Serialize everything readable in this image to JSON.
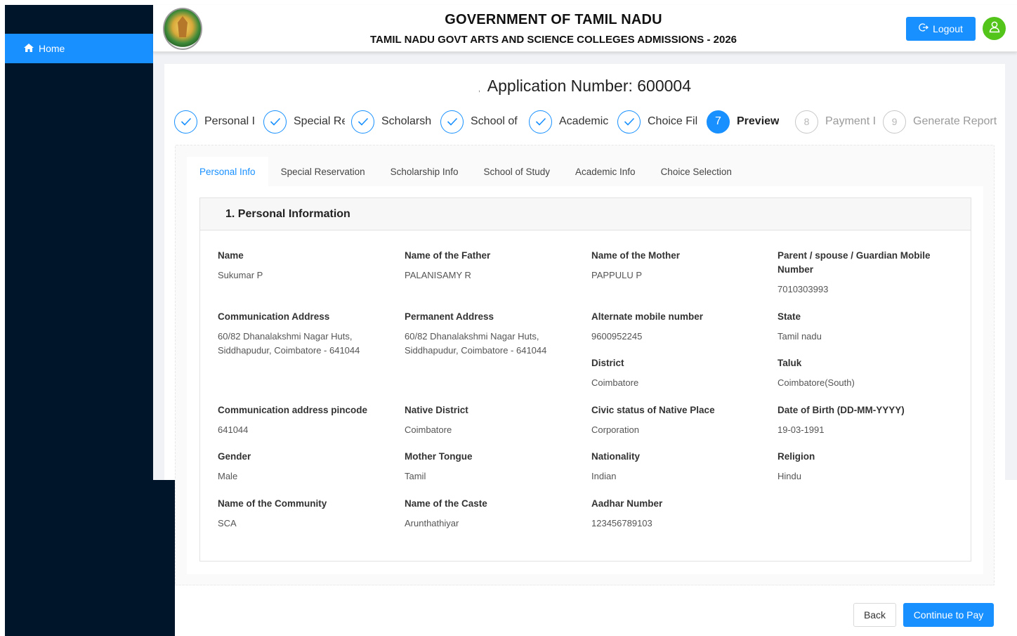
{
  "header": {
    "title": "GOVERNMENT OF TAMIL NADU",
    "subtitle": "TAMIL NADU GOVT ARTS AND SCIENCE COLLEGES ADMISSIONS - 2026",
    "logout_label": "Logout",
    "logout_icon": "logout-icon",
    "avatar_icon": "user-icon"
  },
  "sidebar": {
    "items": [
      {
        "label": "Home",
        "icon": "home-icon",
        "active": true
      }
    ]
  },
  "application": {
    "prefix": ",",
    "label": "Application Number: 600004"
  },
  "steps": [
    {
      "number": "1",
      "label": "Personal I",
      "status": "finish"
    },
    {
      "number": "2",
      "label": "Special Re",
      "status": "finish"
    },
    {
      "number": "3",
      "label": "Scholarsh",
      "status": "finish"
    },
    {
      "number": "4",
      "label": "School of",
      "status": "finish"
    },
    {
      "number": "5",
      "label": "Academic",
      "status": "finish"
    },
    {
      "number": "6",
      "label": "Choice Fil",
      "status": "finish"
    },
    {
      "number": "7",
      "label": "Preview",
      "status": "process"
    },
    {
      "number": "8",
      "label": "Payment I",
      "status": "wait"
    },
    {
      "number": "9",
      "label": "Generate Report",
      "status": "wait"
    }
  ],
  "tabs": [
    {
      "label": "Personal Info",
      "active": true
    },
    {
      "label": "Special Reservation"
    },
    {
      "label": "Scholarship Info"
    },
    {
      "label": "School of Study"
    },
    {
      "label": "Academic Info"
    },
    {
      "label": "Choice Selection"
    }
  ],
  "section": {
    "title": "1. Personal Information"
  },
  "fields": [
    {
      "label": "Name",
      "value": "Sukumar P"
    },
    {
      "label": "Name of the Father",
      "value": "PALANISAMY R"
    },
    {
      "label": "Name of the Mother",
      "value": "PAPPULU P"
    },
    {
      "label": "Parent / spouse / Guardian Mobile Number",
      "value": "7010303993"
    },
    {
      "label": "Communication Address",
      "value": "60/82 Dhanalakshmi Nagar Huts, Siddhapudur, Coimbatore - 641044"
    },
    {
      "label": "Permanent Address",
      "value": "60/82 Dhanalakshmi Nagar Huts, Siddhapudur, Coimbatore - 641044"
    },
    {
      "label": "Alternate mobile number",
      "value": "9600952245"
    },
    {
      "label": "State",
      "value": "Tamil nadu"
    },
    {
      "label": "District",
      "value": "Coimbatore"
    },
    {
      "label": "Taluk",
      "value": "Coimbatore(South)"
    },
    {
      "label": "Communication address pincode",
      "value": "641044"
    },
    {
      "label": "Native District",
      "value": "Coimbatore"
    },
    {
      "label": "Civic status of Native Place",
      "value": "Corporation"
    },
    {
      "label": "Date of Birth (DD-MM-YYYY)",
      "value": "19-03-1991"
    },
    {
      "label": "Gender",
      "value": "Male"
    },
    {
      "label": "Mother Tongue",
      "value": "Tamil"
    },
    {
      "label": "Nationality",
      "value": "Indian"
    },
    {
      "label": "Religion",
      "value": "Hindu"
    },
    {
      "label": "Name of the Community",
      "value": "SCA"
    },
    {
      "label": "Name of the Caste",
      "value": "Arunthathiyar"
    },
    {
      "label": "Aadhar Number",
      "value": "123456789103"
    }
  ],
  "footer": {
    "back_label": "Back",
    "continue_label": "Continue to Pay"
  },
  "colors": {
    "primary": "#1890ff",
    "sidebar": "#001529",
    "avatar": "#52c41a"
  }
}
